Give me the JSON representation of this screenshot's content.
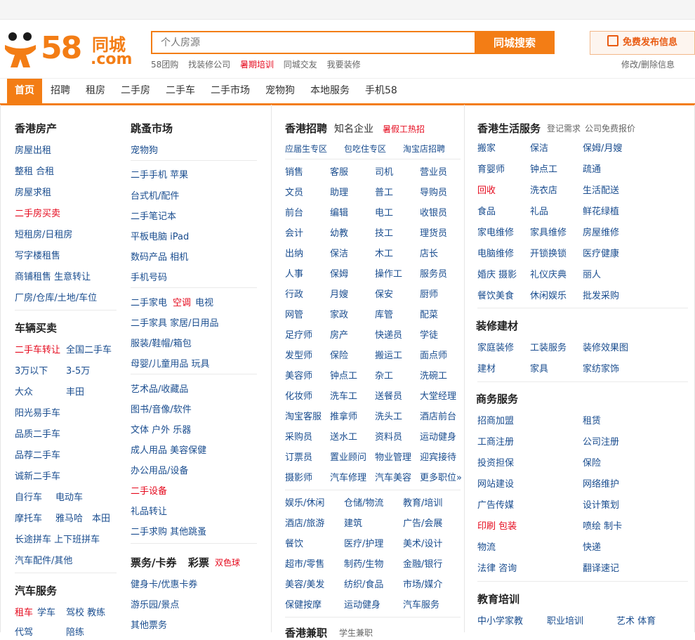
{
  "logo": {
    "number": "58",
    "cn": "同城",
    "com": ".com"
  },
  "search": {
    "placeholder": "个人房源",
    "button": "同城搜索",
    "hotlinks": [
      "58团购",
      "找装修公司",
      "暑期培训",
      "同城交友",
      "我要装修"
    ]
  },
  "publish": {
    "label": "免费发布信息",
    "modify": "修改/删除信息"
  },
  "nav": [
    "首页",
    "招聘",
    "租房",
    "二手房",
    "二手车",
    "二手市场",
    "宠物狗",
    "本地服务",
    "手机58"
  ],
  "col1": {
    "house_title": "香港房产",
    "house": [
      "房屋出租",
      "整租 合租",
      "房屋求租",
      "二手房买卖",
      "短租房/日租房",
      "写字楼租售",
      "商铺租售 生意转让",
      "厂房/仓库/土地/车位"
    ],
    "car_title": "车辆买卖",
    "car": [
      [
        "二手车转让",
        "全国二手车"
      ],
      [
        "3万以下",
        "3-5万"
      ],
      [
        "大众",
        "丰田"
      ],
      [
        "阳光易手车"
      ],
      [
        "品质二手车"
      ],
      [
        "品荐二手车"
      ],
      [
        "诚新二手车"
      ],
      [
        "自行车",
        "电动车"
      ],
      [
        "摩托车",
        "雅马哈",
        "本田"
      ],
      [
        "长途拼车 上下班拼车"
      ],
      [
        "汽车配件/其他"
      ]
    ],
    "carsvc_title": "汽车服务",
    "carsvc": [
      "租车",
      "学车",
      "驾校 教练"
    ],
    "carsvc2": [
      "代驾",
      "陪练"
    ]
  },
  "col2": {
    "market_title": "跳蚤市场",
    "pet": "宠物狗",
    "g1": [
      "二手手机 苹果",
      "台式机/配件",
      "二手笔记本",
      "平板电脑 iPad",
      "数码产品 相机",
      "手机号码"
    ],
    "g2": [
      [
        "二手家电",
        "空调",
        "电视"
      ],
      [
        "二手家具 家居/日用品"
      ],
      [
        "服装/鞋帽/箱包"
      ],
      [
        "母婴/儿童用品 玩具"
      ]
    ],
    "g3": [
      "艺术品/收藏品",
      "图书/音像/软件",
      "文体 户外 乐器",
      "成人用品 美容保健",
      "办公用品/设备",
      "二手设备",
      "礼品转让",
      "二手求购 其他跳蚤"
    ],
    "ticket_title": "票务/卡券",
    "lottery": "彩票",
    "ball": "双色球",
    "tickets": [
      "健身卡/优惠卡券",
      "游乐园/景点",
      "其他票务"
    ]
  },
  "col3": {
    "title": "香港招聘",
    "sub": "知名企业",
    "hot": "暑假工热招",
    "zones": [
      "应届生专区",
      "包吃住专区",
      "淘宝店招聘"
    ],
    "jobs": [
      [
        "销售",
        "客服",
        "司机",
        "营业员"
      ],
      [
        "文员",
        "助理",
        "普工",
        "导购员"
      ],
      [
        "前台",
        "编辑",
        "电工",
        "收银员"
      ],
      [
        "会计",
        "幼教",
        "技工",
        "理货员"
      ],
      [
        "出纳",
        "保洁",
        "木工",
        "店长"
      ],
      [
        "人事",
        "保姆",
        "操作工",
        "服务员"
      ],
      [
        "行政",
        "月嫂",
        "保安",
        "厨师"
      ],
      [
        "网管",
        "家政",
        "库管",
        "配菜"
      ],
      [
        "足疗师",
        "房产",
        "快递员",
        "学徒"
      ],
      [
        "发型师",
        "保险",
        "搬运工",
        "面点师"
      ],
      [
        "美容师",
        "钟点工",
        "杂工",
        "洗碗工"
      ],
      [
        "化妆师",
        "洗车工",
        "送餐员",
        "大堂经理"
      ],
      [
        "淘宝客服",
        "推拿师",
        "洗头工",
        "酒店前台"
      ],
      [
        "采购员",
        "送水工",
        "资料员",
        "运动健身"
      ],
      [
        "订票员",
        "置业顾问",
        "物业管理",
        "迎宾接待"
      ],
      [
        "摄影师",
        "汽车修理",
        "汽车美容",
        "更多职位»"
      ]
    ],
    "cats": [
      [
        "娱乐/休闲",
        "仓储/物流",
        "教育/培训"
      ],
      [
        "酒店/旅游",
        "建筑",
        "广告/会展"
      ],
      [
        "餐饮",
        "医疗/护理",
        "美术/设计"
      ],
      [
        "超市/零售",
        "制药/生物",
        "金融/银行"
      ],
      [
        "美容/美发",
        "纺织/食品",
        "市场/媒介"
      ],
      [
        "保健按摩",
        "运动健身",
        "汽车服务"
      ]
    ],
    "bottom_title": "香港兼职",
    "bottom_sub": "学生兼职"
  },
  "col4": {
    "life_title": "香港生活服务",
    "life_links": [
      "登记需求",
      "公司免费报价"
    ],
    "life": [
      [
        "搬家",
        "保洁",
        "保姆/月嫂"
      ],
      [
        "育婴师",
        "钟点工",
        "疏通"
      ],
      [
        "回收",
        "洗衣店",
        "生活配送"
      ],
      [
        "食品",
        "礼品",
        "鲜花绿植"
      ],
      [
        "家电维修",
        "家具维修",
        "房屋维修"
      ],
      [
        "电脑维修",
        "开锁换锁",
        "医疗健康"
      ],
      [
        "婚庆 摄影",
        "礼仪庆典",
        "丽人"
      ],
      [
        "餐饮美食",
        "休闲娱乐",
        "批发采购"
      ]
    ],
    "deco_title": "装修建材",
    "deco": [
      [
        "家庭装修",
        "工装服务",
        "装修效果图"
      ],
      [
        "建材",
        "家具",
        "家纺家饰"
      ]
    ],
    "biz_title": "商务服务",
    "biz": [
      [
        "招商加盟",
        "租赁"
      ],
      [
        "工商注册",
        "公司注册"
      ],
      [
        "投资担保",
        "保险"
      ],
      [
        "网站建设",
        "网络维护"
      ],
      [
        "广告传媒",
        "设计策划"
      ],
      [
        "印刷 包装",
        "喷绘 制卡"
      ],
      [
        "物流",
        "快递"
      ],
      [
        "法律 咨询",
        "翻译速记"
      ]
    ],
    "edu_title": "教育培训",
    "edu": [
      "中小学家教",
      "职业培训",
      "艺术 体育"
    ]
  },
  "colors": {
    "orange": "#f37d15",
    "link": "#1a4d8f",
    "red": "#e5091d"
  }
}
